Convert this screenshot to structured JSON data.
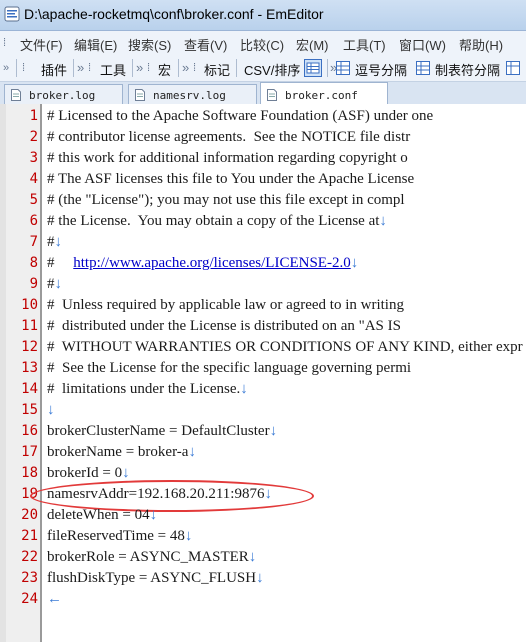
{
  "window": {
    "title": "D:\\apache-rocketmq\\conf\\broker.conf - EmEditor"
  },
  "menu": {
    "items": [
      "文件(F)",
      "编辑(E)",
      "搜索(S)",
      "查看(V)",
      "比较(C)",
      "宏(M)",
      "工具(T)",
      "窗口(W)",
      "帮助(H)"
    ]
  },
  "toolbar": {
    "plugins": "插件",
    "tools": "工具",
    "macro": "宏",
    "markers": "标记",
    "csv": "CSV/排序",
    "comma": "逗号分隔",
    "tab": "制表符分隔"
  },
  "tabs": [
    {
      "label": "broker.log",
      "active": false
    },
    {
      "label": "namesrv.log",
      "active": false
    },
    {
      "label": "broker.conf",
      "active": true
    }
  ],
  "eol_mark": "↓",
  "eof_mark": "←",
  "lines": [
    {
      "n": "1",
      "text": "# Licensed to the Apache Software Foundation (ASF) under one"
    },
    {
      "n": "2",
      "text": "# contributor license agreements.  See the NOTICE file distr"
    },
    {
      "n": "3",
      "text": "# this work for additional information regarding copyright o"
    },
    {
      "n": "4",
      "text": "# The ASF licenses this file to You under the Apache License"
    },
    {
      "n": "5",
      "text": "# (the \"License\"); you may not use this file except in compl"
    },
    {
      "n": "6",
      "text": "# the License.  You may obtain a copy of the License at",
      "eol": true
    },
    {
      "n": "7",
      "text": "#",
      "eol": true
    },
    {
      "n": "8",
      "text": "#     ",
      "url": "http://www.apache.org/licenses/LICENSE-2.0",
      "eol": true
    },
    {
      "n": "9",
      "text": "#",
      "eol": true
    },
    {
      "n": "10",
      "text": "#  Unless required by applicable law or agreed to in writing"
    },
    {
      "n": "11",
      "text": "#  distributed under the License is distributed on an \"AS IS"
    },
    {
      "n": "12",
      "text": "#  WITHOUT WARRANTIES OR CONDITIONS OF ANY KIND, either expr"
    },
    {
      "n": "13",
      "text": "#  See the License for the specific language governing permi"
    },
    {
      "n": "14",
      "text": "#  limitations under the License.",
      "eol": true
    },
    {
      "n": "15",
      "text": "",
      "eol": true
    },
    {
      "n": "16",
      "text": "brokerClusterName = DefaultCluster",
      "eol": true
    },
    {
      "n": "17",
      "text": "brokerName = broker-a",
      "eol": true
    },
    {
      "n": "18",
      "text": "brokerId = 0",
      "eol": true
    },
    {
      "n": "19",
      "text": "namesrvAddr=192.168.20.211:9876",
      "eol": true
    },
    {
      "n": "20",
      "text": "deleteWhen = 04",
      "eol": true
    },
    {
      "n": "21",
      "text": "fileReservedTime = 48",
      "eol": true
    },
    {
      "n": "22",
      "text": "brokerRole = ASYNC_MASTER",
      "eol": true
    },
    {
      "n": "23",
      "text": "flushDiskType = ASYNC_FLUSH",
      "eol": true
    },
    {
      "n": "24",
      "text": "",
      "eof": true
    }
  ]
}
